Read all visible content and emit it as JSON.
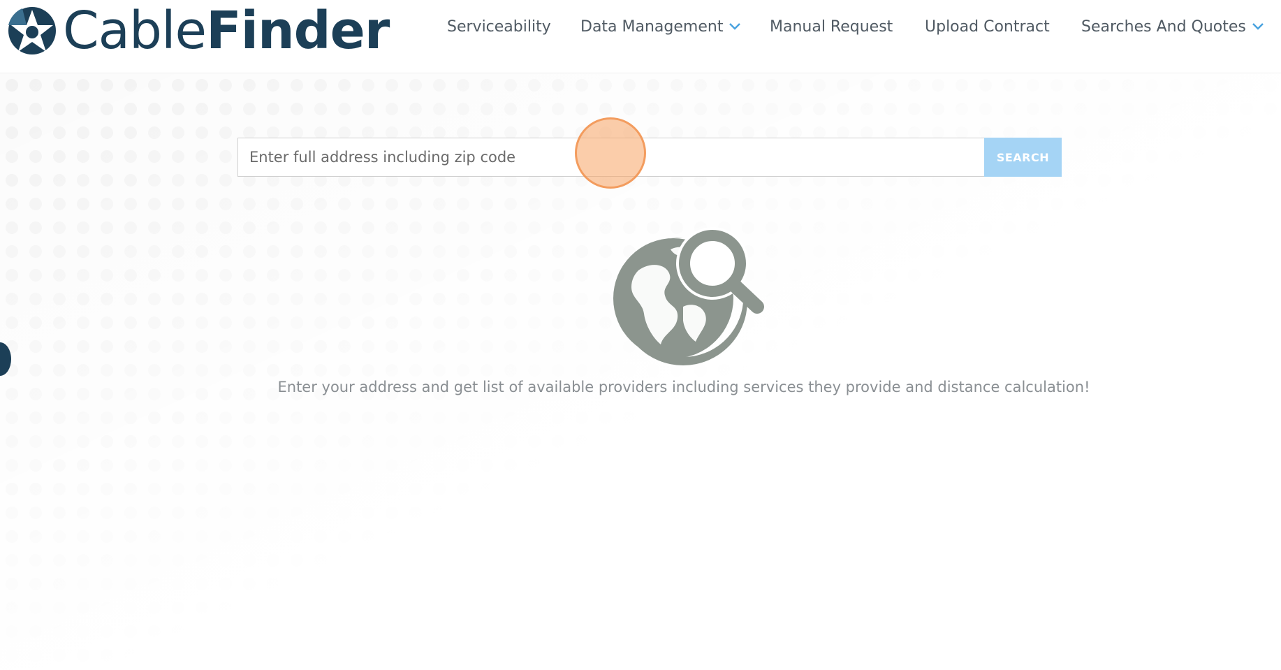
{
  "app": {
    "logo": {
      "word_light": "Cable",
      "word_bold": "Finder",
      "color": "#1c3f57"
    }
  },
  "nav": {
    "items": [
      {
        "label": "Serviceability",
        "has_dropdown": false
      },
      {
        "label": "Data Management",
        "has_dropdown": true
      },
      {
        "label": "Manual Request",
        "has_dropdown": false
      },
      {
        "label": "Upload Contract",
        "has_dropdown": false
      },
      {
        "label": "Searches And Quotes",
        "has_dropdown": true
      }
    ],
    "chevron_color": "#4aa3df"
  },
  "search": {
    "placeholder": "Enter full address including zip code",
    "value": "",
    "button_label": "SEARCH",
    "button_color": "#a5d4f5"
  },
  "hero": {
    "icon": "globe-search-icon",
    "icon_color": "#8c958e",
    "message": "Enter your address and get list of available providers including services they provide and distance calculation!"
  }
}
